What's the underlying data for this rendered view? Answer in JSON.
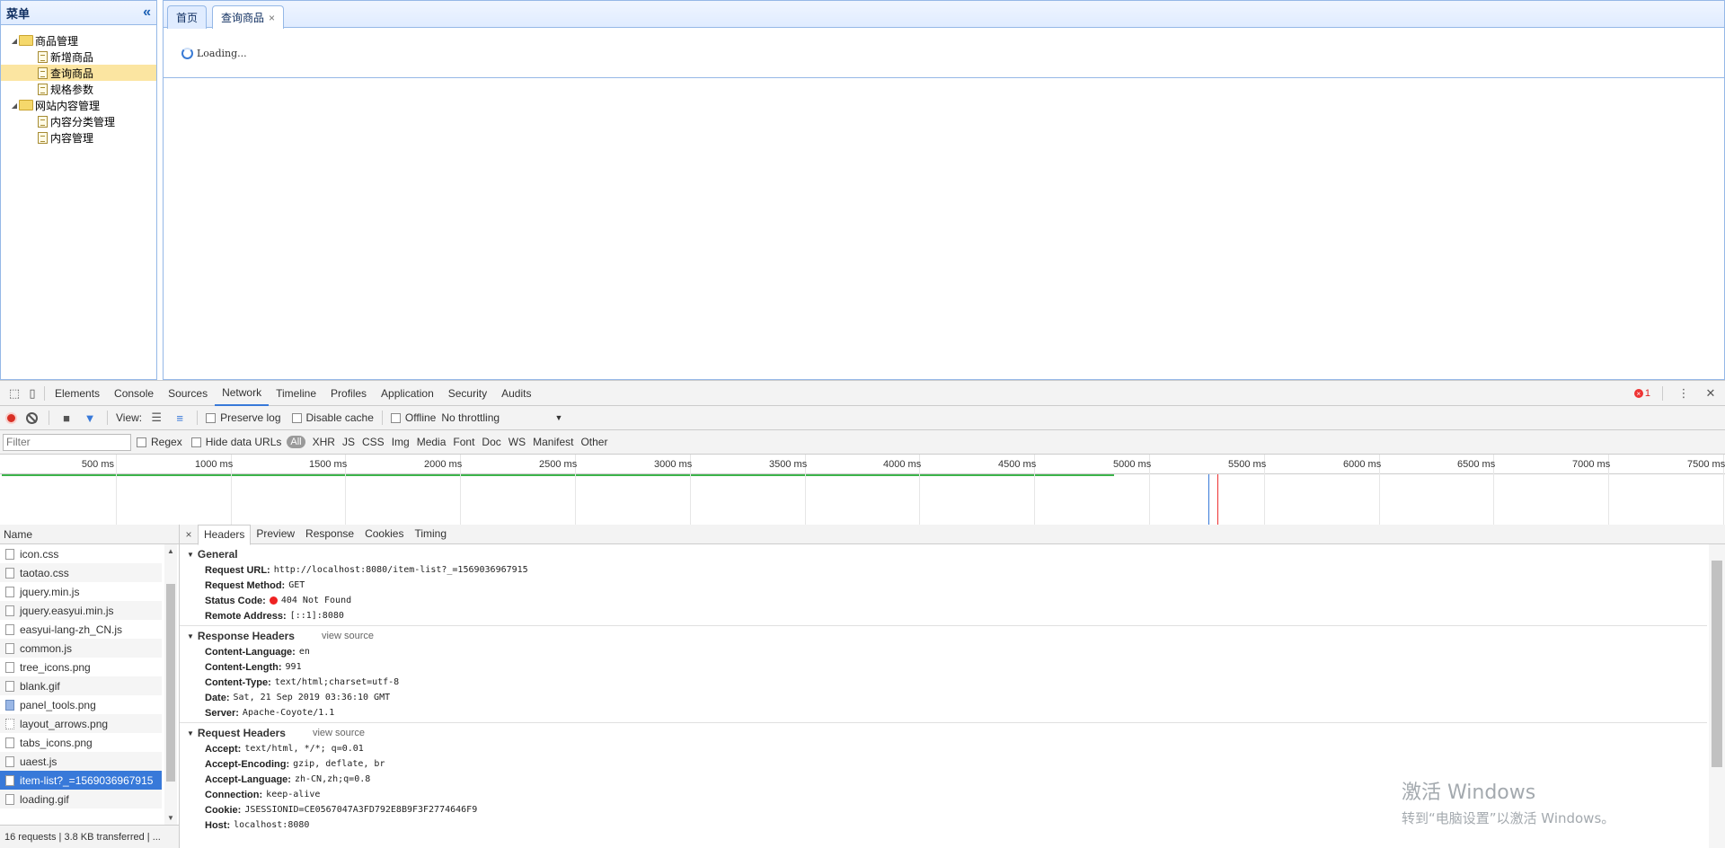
{
  "menu": {
    "title": "菜单",
    "collapse_icon": "«",
    "tree": [
      {
        "label": "商品管理",
        "type": "folder"
      },
      {
        "label": "新增商品",
        "type": "file"
      },
      {
        "label": "查询商品",
        "type": "file",
        "selected": true
      },
      {
        "label": "规格参数",
        "type": "file"
      },
      {
        "label": "网站内容管理",
        "type": "folder"
      },
      {
        "label": "内容分类管理",
        "type": "file"
      },
      {
        "label": "内容管理",
        "type": "file"
      }
    ]
  },
  "tabs": [
    {
      "label": "首页"
    },
    {
      "label": "查询商品",
      "close": "×",
      "active": true
    }
  ],
  "content": {
    "loading_text": "Loading..."
  },
  "devtools": {
    "tabs": [
      "Elements",
      "Console",
      "Sources",
      "Network",
      "Timeline",
      "Profiles",
      "Application",
      "Security",
      "Audits"
    ],
    "active_tab": "Network",
    "error_count": "1",
    "toolbar": {
      "view_label": "View:",
      "preserve_log": "Preserve log",
      "disable_cache": "Disable cache",
      "offline": "Offline",
      "throttling": "No throttling"
    },
    "filter": {
      "placeholder": "Filter",
      "regex": "Regex",
      "hide_data_urls": "Hide data URLs",
      "types": [
        "All",
        "XHR",
        "JS",
        "CSS",
        "Img",
        "Media",
        "Font",
        "Doc",
        "WS",
        "Manifest",
        "Other"
      ]
    },
    "timeline_ticks": [
      "500 ms",
      "1000 ms",
      "1500 ms",
      "2000 ms",
      "2500 ms",
      "3000 ms",
      "3500 ms",
      "4000 ms",
      "4500 ms",
      "5000 ms",
      "5500 ms",
      "6000 ms",
      "6500 ms",
      "7000 ms",
      "7500 ms"
    ],
    "name_header": "Name",
    "requests": [
      {
        "name": "icon.css",
        "kind": "file"
      },
      {
        "name": "taotao.css",
        "kind": "file"
      },
      {
        "name": "jquery.min.js",
        "kind": "file"
      },
      {
        "name": "jquery.easyui.min.js",
        "kind": "file"
      },
      {
        "name": "easyui-lang-zh_CN.js",
        "kind": "file"
      },
      {
        "name": "common.js",
        "kind": "file"
      },
      {
        "name": "tree_icons.png",
        "kind": "file"
      },
      {
        "name": "blank.gif",
        "kind": "file"
      },
      {
        "name": "panel_tools.png",
        "kind": "img"
      },
      {
        "name": "layout_arrows.png",
        "kind": "dot"
      },
      {
        "name": "tabs_icons.png",
        "kind": "file"
      },
      {
        "name": "uaest.js",
        "kind": "file"
      },
      {
        "name": "item-list?_=1569036967915",
        "kind": "file",
        "selected": true
      },
      {
        "name": "loading.gif",
        "kind": "file"
      }
    ],
    "status_text": "16 requests | 3.8 KB transferred | ...",
    "detail_tabs": [
      "Headers",
      "Preview",
      "Response",
      "Cookies",
      "Timing"
    ],
    "detail_close": "×",
    "general": {
      "title": "General",
      "rows": [
        {
          "k": "Request URL:",
          "v": "http://localhost:8080/item-list?_=1569036967915"
        },
        {
          "k": "Request Method:",
          "v": "GET"
        },
        {
          "k": "Status Code:",
          "v": "404 Not Found",
          "dot": true
        },
        {
          "k": "Remote Address:",
          "v": "[::1]:8080"
        }
      ]
    },
    "response_headers": {
      "title": "Response Headers",
      "view_source": "view source",
      "rows": [
        {
          "k": "Content-Language:",
          "v": "en"
        },
        {
          "k": "Content-Length:",
          "v": "991"
        },
        {
          "k": "Content-Type:",
          "v": "text/html;charset=utf-8"
        },
        {
          "k": "Date:",
          "v": "Sat, 21 Sep 2019 03:36:10 GMT"
        },
        {
          "k": "Server:",
          "v": "Apache-Coyote/1.1"
        }
      ]
    },
    "request_headers": {
      "title": "Request Headers",
      "view_source": "view source",
      "rows": [
        {
          "k": "Accept:",
          "v": "text/html, */*; q=0.01"
        },
        {
          "k": "Accept-Encoding:",
          "v": "gzip, deflate, br"
        },
        {
          "k": "Accept-Language:",
          "v": "zh-CN,zh;q=0.8"
        },
        {
          "k": "Connection:",
          "v": "keep-alive"
        },
        {
          "k": "Cookie:",
          "v": "JSESSIONID=CE0567047A3FD792E8B9F3F2774646F9"
        },
        {
          "k": "Host:",
          "v": "localhost:8080"
        }
      ]
    }
  },
  "watermark": {
    "line1": "激活 Windows",
    "line2": "转到“电脑设置”以激活 Windows。"
  }
}
